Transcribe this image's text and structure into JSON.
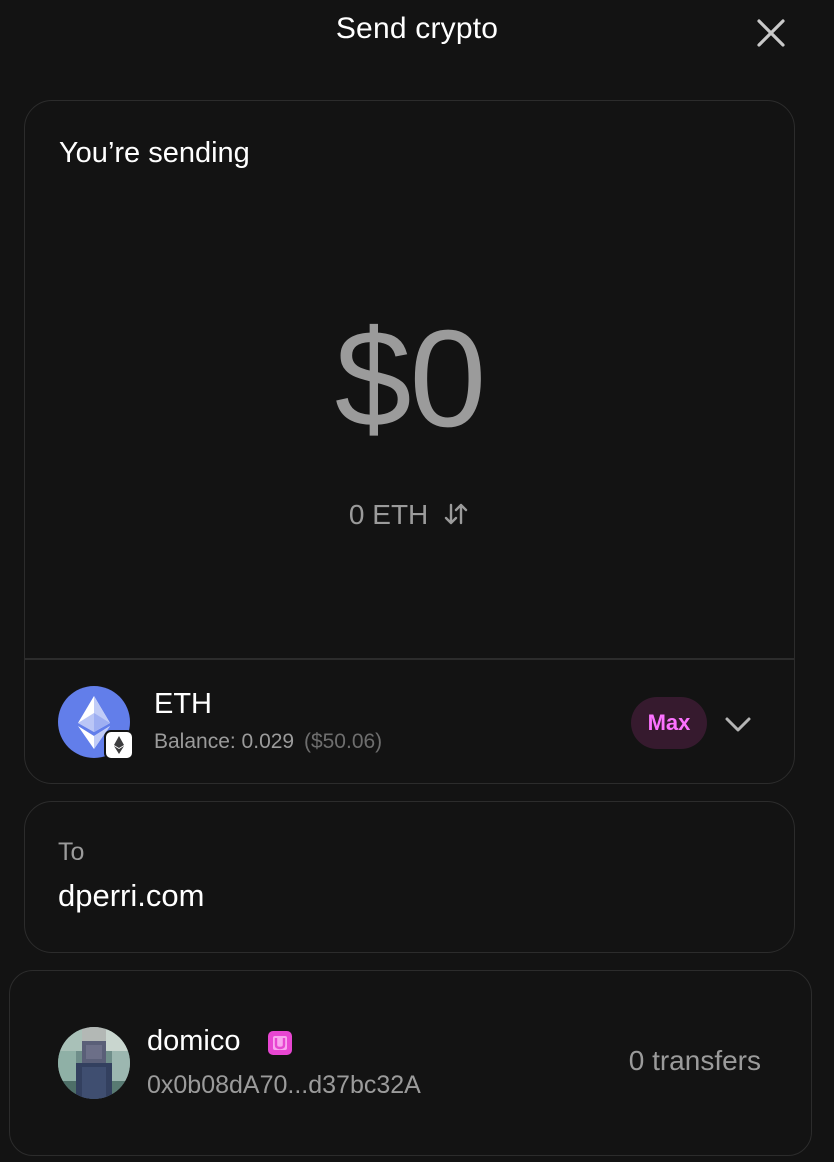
{
  "header": {
    "title": "Send crypto",
    "close_icon": "close-icon"
  },
  "send": {
    "label": "You’re sending",
    "fiat_amount": "$0",
    "token_amount": "0 ETH",
    "swap_icon": "swap-vertical-icon"
  },
  "token": {
    "symbol": "ETH",
    "balance_label": "Balance: 0.029",
    "balance_usd": "($50.06)",
    "max_label": "Max",
    "logo_icon": "eth-logo-icon",
    "chain_icon": "ethereum-chain-icon",
    "chevron_icon": "chevron-down-icon"
  },
  "to": {
    "label": "To",
    "value": "dperri.com"
  },
  "recipient": {
    "name": "domico",
    "address": "0x0b08dA70...d37bc32A",
    "transfers": "0 transfers",
    "badge_icon": "unitag-badge-icon"
  },
  "colors": {
    "background": "#131313",
    "border": "#2c2c2c",
    "accent_pink": "#fc72ff",
    "eth_blue": "#627eea",
    "muted_text": "#9b9b9b"
  }
}
